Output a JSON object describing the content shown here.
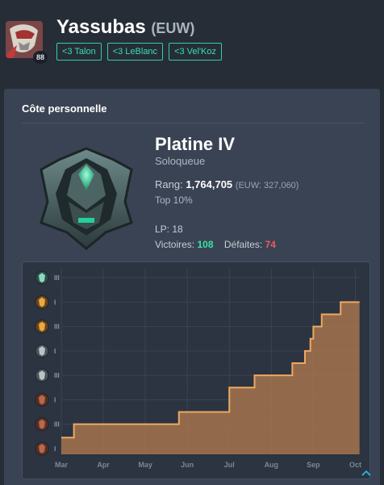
{
  "profile": {
    "name": "Yassubas",
    "region": "(EUW)",
    "level": "88",
    "tags": [
      "<3 Talon",
      "<3 LeBlanc",
      "<3 Vel'Koz"
    ]
  },
  "ranked": {
    "section_title": "Côte personnelle",
    "tier": "Platine IV",
    "queue": "Soloqueue",
    "rank_label": "Rang:",
    "rank_value": "1,764,705",
    "rank_region": "(EUW: 327,060)",
    "top_percent": "Top 10%",
    "lp_label": "LP:",
    "lp_value": "18",
    "wins_label": "Victoires:",
    "wins_value": "108",
    "losses_label": "Défaites:",
    "losses_value": "74"
  },
  "colors": {
    "accent": "#35e0b0",
    "wins": "#3ce0a6",
    "losses": "#ee5a63",
    "line": "#f0a860",
    "fill": "#a4744e"
  },
  "icons": [
    "champion-avatar-icon",
    "platinum-emblem-icon",
    "rank-tier-icon",
    "chevron-up-icon"
  ],
  "chart_data": {
    "type": "area",
    "title": "",
    "xlabel": "",
    "ylabel": "",
    "x_ticks": [
      "Mar",
      "Apr",
      "May",
      "Jun",
      "Jul",
      "Aug",
      "Sep",
      "Oct"
    ],
    "y_ticks": [
      {
        "tier": "bronze",
        "division": "I"
      },
      {
        "tier": "bronze",
        "division": "III"
      },
      {
        "tier": "bronze",
        "division": "I"
      },
      {
        "tier": "silver",
        "division": "III"
      },
      {
        "tier": "silver",
        "division": "I"
      },
      {
        "tier": "gold",
        "division": "III"
      },
      {
        "tier": "gold",
        "division": "I"
      },
      {
        "tier": "platinum",
        "division": "III"
      }
    ],
    "ylim": [
      0,
      7
    ],
    "xlim": [
      1,
      8
    ],
    "step_points": [
      {
        "x": 1.0,
        "y": 0.45
      },
      {
        "x": 1.3,
        "y": 1.0
      },
      {
        "x": 3.8,
        "y": 1.5
      },
      {
        "x": 5.0,
        "y": 2.5
      },
      {
        "x": 5.6,
        "y": 3.0
      },
      {
        "x": 6.5,
        "y": 3.5
      },
      {
        "x": 6.8,
        "y": 4.0
      },
      {
        "x": 6.93,
        "y": 4.5
      },
      {
        "x": 7.0,
        "y": 5.0
      },
      {
        "x": 7.2,
        "y": 5.5
      },
      {
        "x": 7.65,
        "y": 6.0
      },
      {
        "x": 8.1,
        "y": 6.0
      }
    ]
  }
}
